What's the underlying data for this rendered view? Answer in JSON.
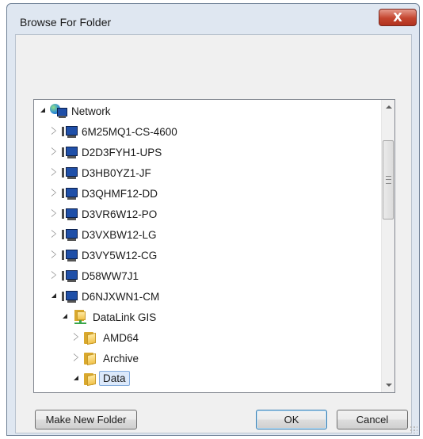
{
  "window": {
    "title": "Browse For Folder",
    "close_glyph": "X"
  },
  "dialog": {
    "instructions": ""
  },
  "tree": {
    "items": [
      {
        "label": "Network",
        "icon": "network-icon",
        "expanded": true
      },
      {
        "label": "6M25MQ1-CS-4600",
        "icon": "computer-icon",
        "expanded": false
      },
      {
        "label": "D2D3FYH1-UPS",
        "icon": "computer-icon",
        "expanded": false
      },
      {
        "label": "D3HB0YZ1-JF",
        "icon": "computer-icon",
        "expanded": false
      },
      {
        "label": "D3QHMF12-DD",
        "icon": "computer-icon",
        "expanded": false
      },
      {
        "label": "D3VR6W12-PO",
        "icon": "computer-icon",
        "expanded": false
      },
      {
        "label": "D3VXBW12-LG",
        "icon": "computer-icon",
        "expanded": false
      },
      {
        "label": "D3VY5W12-CG",
        "icon": "computer-icon",
        "expanded": false
      },
      {
        "label": "D58WW7J1",
        "icon": "computer-icon",
        "expanded": false
      },
      {
        "label": "D6NJXWN1-CM",
        "icon": "computer-icon",
        "expanded": true
      },
      {
        "label": "DataLink GIS",
        "icon": "shared-folder-icon",
        "expanded": true
      },
      {
        "label": "AMD64",
        "icon": "folder-icon",
        "expanded": false
      },
      {
        "label": "Archive",
        "icon": "folder-icon",
        "expanded": false
      },
      {
        "label": "Data",
        "icon": "folder-icon",
        "expanded": true,
        "selected": true
      }
    ]
  },
  "buttons": {
    "make_new_folder": "Make New Folder",
    "ok": "OK",
    "cancel": "Cancel"
  },
  "colors": {
    "selection_fill": "#dce9fb",
    "selection_border": "#84acdd",
    "close_button": "#c4452f",
    "window_frame": "#dfe7f1"
  }
}
